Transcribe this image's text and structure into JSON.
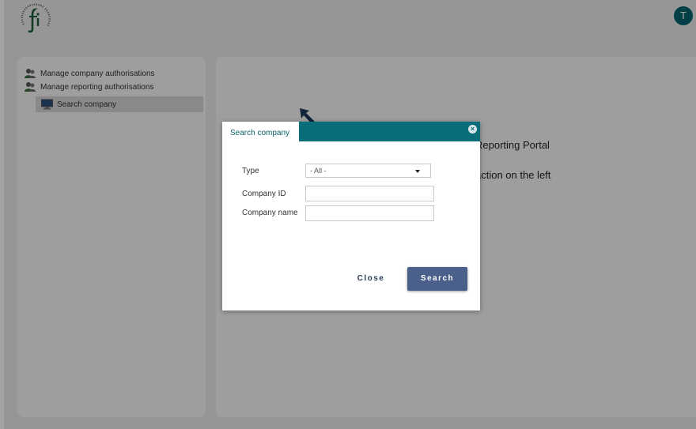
{
  "header": {
    "avatar_initial": "T"
  },
  "sidebar": {
    "items": [
      {
        "label": "Manage company authorisations",
        "icon": "users-icon"
      },
      {
        "label": "Manage reporting authorisations",
        "icon": "users-icon"
      },
      {
        "label": "Search company",
        "icon": "monitor-icon",
        "selected": true
      }
    ]
  },
  "main": {
    "text_line1": "Reporting Portal",
    "text_line2": "action on the left"
  },
  "dialog": {
    "title": "Search company",
    "fields": {
      "type_label": "Type",
      "type_value": "- All -",
      "company_id_label": "Company ID",
      "company_id_value": "",
      "company_name_label": "Company name",
      "company_name_value": ""
    },
    "close_label": "Close",
    "search_label": "Search"
  },
  "colors": {
    "teal": "#0a6d7a",
    "button": "#4a5f8a",
    "avatar": "#03646f"
  }
}
